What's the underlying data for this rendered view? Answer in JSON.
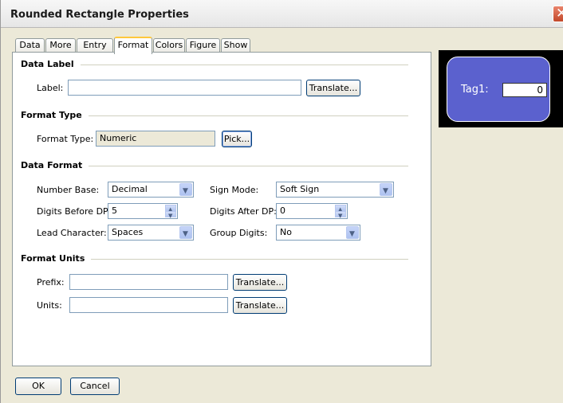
{
  "window": {
    "title": "Rounded Rectangle Properties",
    "close_glyph": "✕"
  },
  "tabs": [
    {
      "label": "Data"
    },
    {
      "label": "More"
    },
    {
      "label": "Entry"
    },
    {
      "label": "Format"
    },
    {
      "label": "Colors"
    },
    {
      "label": "Figure"
    },
    {
      "label": "Show"
    }
  ],
  "active_tab": "Format",
  "data_label": {
    "section": "Data Label",
    "label_caption": "Label:",
    "label_value": "",
    "translate_button": "Translate..."
  },
  "format_type": {
    "section": "Format Type",
    "caption": "Format Type:",
    "value": "Numeric",
    "pick_button": "Pick..."
  },
  "data_format": {
    "section": "Data Format",
    "number_base_caption": "Number Base:",
    "number_base_value": "Decimal",
    "sign_mode_caption": "Sign Mode:",
    "sign_mode_value": "Soft Sign",
    "digits_before_caption": "Digits Before DP:",
    "digits_before_value": "5",
    "digits_after_caption": "Digits After DP:",
    "digits_after_value": "0",
    "lead_char_caption": "Lead Character:",
    "lead_char_value": "Spaces",
    "group_digits_caption": "Group Digits:",
    "group_digits_value": "No"
  },
  "format_units": {
    "section": "Format Units",
    "prefix_caption": "Prefix:",
    "prefix_value": "",
    "units_caption": "Units:",
    "units_value": "",
    "translate_button": "Translate..."
  },
  "buttons": {
    "ok": "OK",
    "cancel": "Cancel"
  },
  "preview": {
    "tag_label": "Tag1:",
    "tag_value": "0",
    "fill_color": "#5b61ce"
  }
}
